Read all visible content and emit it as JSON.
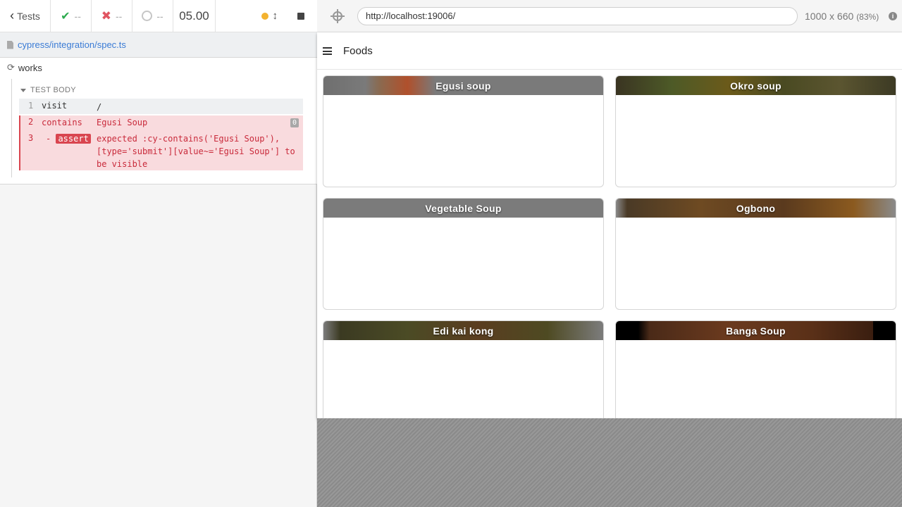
{
  "reporter": {
    "back_label": "Tests",
    "passed": "--",
    "failed": "--",
    "pending": "--",
    "duration": "05.00",
    "spec_path": "cypress/integration/spec.ts",
    "test_title": "works",
    "body_label": "TEST BODY",
    "commands": [
      {
        "num": "1",
        "name": "visit",
        "message": "/"
      },
      {
        "num": "2",
        "name": "contains",
        "message": "Egusi Soup",
        "badge": "0"
      },
      {
        "num": "3",
        "name": "- assert",
        "tag": "assert",
        "message": "expected :cy-contains('Egusi Soup'), [type='submit'][value~='Egusi Soup'] to be visible"
      }
    ],
    "colors": {
      "pass": "#2dab4f",
      "fail": "#e05561",
      "running": "#f3b22f",
      "link": "#3a7bd5"
    }
  },
  "aut": {
    "url": "http://localhost:19006/",
    "viewport": "1000 x 660",
    "scale": "(83%)",
    "app_title": "Foods",
    "foods": [
      {
        "name": "Egusi soup"
      },
      {
        "name": "Okro soup"
      },
      {
        "name": "Vegetable Soup"
      },
      {
        "name": "Ogbono"
      },
      {
        "name": "Edi kai kong"
      },
      {
        "name": "Banga Soup"
      }
    ]
  }
}
